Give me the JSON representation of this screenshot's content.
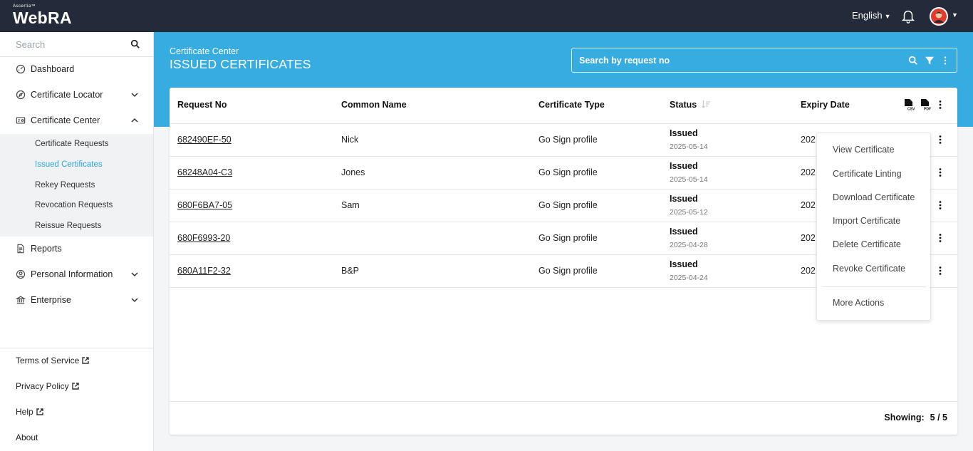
{
  "app": {
    "brand_small": "Ascertia™",
    "brand": "WebRA",
    "language": "English"
  },
  "sidebar": {
    "search_placeholder": "Search",
    "items": [
      {
        "label": "Dashboard"
      },
      {
        "label": "Certificate Locator"
      },
      {
        "label": "Certificate Center"
      },
      {
        "label": "Reports"
      },
      {
        "label": "Personal Information"
      },
      {
        "label": "Enterprise"
      }
    ],
    "sub_items": [
      {
        "label": "Certificate Requests"
      },
      {
        "label": "Issued Certificates"
      },
      {
        "label": "Rekey Requests"
      },
      {
        "label": "Revocation Requests"
      },
      {
        "label": "Reissue Requests"
      }
    ],
    "footer": [
      {
        "label": "Terms of Service"
      },
      {
        "label": "Privacy Policy"
      },
      {
        "label": "Help"
      },
      {
        "label": "About"
      }
    ]
  },
  "header": {
    "breadcrumb": "Certificate Center",
    "title": "ISSUED CERTIFICATES",
    "search_placeholder": "Search by request no"
  },
  "table": {
    "columns": [
      "Request No",
      "Common Name",
      "Certificate Type",
      "Status",
      "Expiry Date"
    ],
    "rows": [
      {
        "request_no": "682490EF-50",
        "common_name": "Nick",
        "type": "Go Sign profile",
        "status": "Issued",
        "status_date": "2025-05-14",
        "expiry": "202"
      },
      {
        "request_no": "68248A04-C3",
        "common_name": "Jones",
        "type": "Go Sign profile",
        "status": "Issued",
        "status_date": "2025-05-14",
        "expiry": "202"
      },
      {
        "request_no": "680F6BA7-05",
        "common_name": "Sam",
        "type": "Go Sign profile",
        "status": "Issued",
        "status_date": "2025-05-12",
        "expiry": "202"
      },
      {
        "request_no": "680F6993-20",
        "common_name": "",
        "type": "Go Sign profile",
        "status": "Issued",
        "status_date": "2025-04-28",
        "expiry": "202"
      },
      {
        "request_no": "680A11F2-32",
        "common_name": "B&P",
        "type": "Go Sign profile",
        "status": "Issued",
        "status_date": "2025-04-24",
        "expiry": "202"
      }
    ],
    "showing_label": "Showing:",
    "showing_value": "5 / 5"
  },
  "menu": {
    "items": [
      {
        "label": "View Certificate"
      },
      {
        "label": "Certificate Linting"
      },
      {
        "label": "Download Certificate"
      },
      {
        "label": "Import Certificate"
      },
      {
        "label": "Delete Certificate"
      },
      {
        "label": "Revoke Certificate"
      },
      {
        "label": "More Actions"
      }
    ]
  },
  "colors": {
    "topbar": "#232b3a",
    "header_band": "#36ace0",
    "active_link": "#2fa6dd"
  },
  "icons": {
    "export_csv": "csv-file-icon",
    "export_pdf": "pdf-file-icon"
  }
}
